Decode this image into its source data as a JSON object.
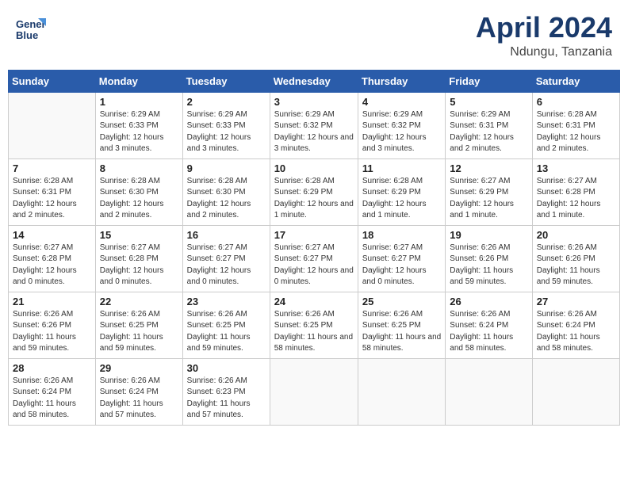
{
  "header": {
    "logo_text_1": "General",
    "logo_text_2": "Blue",
    "month": "April 2024",
    "location": "Ndungu, Tanzania"
  },
  "days_of_week": [
    "Sunday",
    "Monday",
    "Tuesday",
    "Wednesday",
    "Thursday",
    "Friday",
    "Saturday"
  ],
  "weeks": [
    [
      {
        "day": "",
        "info": ""
      },
      {
        "day": "1",
        "info": "Sunrise: 6:29 AM\nSunset: 6:33 PM\nDaylight: 12 hours\nand 3 minutes."
      },
      {
        "day": "2",
        "info": "Sunrise: 6:29 AM\nSunset: 6:33 PM\nDaylight: 12 hours\nand 3 minutes."
      },
      {
        "day": "3",
        "info": "Sunrise: 6:29 AM\nSunset: 6:32 PM\nDaylight: 12 hours\nand 3 minutes."
      },
      {
        "day": "4",
        "info": "Sunrise: 6:29 AM\nSunset: 6:32 PM\nDaylight: 12 hours\nand 3 minutes."
      },
      {
        "day": "5",
        "info": "Sunrise: 6:29 AM\nSunset: 6:31 PM\nDaylight: 12 hours\nand 2 minutes."
      },
      {
        "day": "6",
        "info": "Sunrise: 6:28 AM\nSunset: 6:31 PM\nDaylight: 12 hours\nand 2 minutes."
      }
    ],
    [
      {
        "day": "7",
        "info": "Sunrise: 6:28 AM\nSunset: 6:31 PM\nDaylight: 12 hours\nand 2 minutes."
      },
      {
        "day": "8",
        "info": "Sunrise: 6:28 AM\nSunset: 6:30 PM\nDaylight: 12 hours\nand 2 minutes."
      },
      {
        "day": "9",
        "info": "Sunrise: 6:28 AM\nSunset: 6:30 PM\nDaylight: 12 hours\nand 2 minutes."
      },
      {
        "day": "10",
        "info": "Sunrise: 6:28 AM\nSunset: 6:29 PM\nDaylight: 12 hours\nand 1 minute."
      },
      {
        "day": "11",
        "info": "Sunrise: 6:28 AM\nSunset: 6:29 PM\nDaylight: 12 hours\nand 1 minute."
      },
      {
        "day": "12",
        "info": "Sunrise: 6:27 AM\nSunset: 6:29 PM\nDaylight: 12 hours\nand 1 minute."
      },
      {
        "day": "13",
        "info": "Sunrise: 6:27 AM\nSunset: 6:28 PM\nDaylight: 12 hours\nand 1 minute."
      }
    ],
    [
      {
        "day": "14",
        "info": "Sunrise: 6:27 AM\nSunset: 6:28 PM\nDaylight: 12 hours\nand 0 minutes."
      },
      {
        "day": "15",
        "info": "Sunrise: 6:27 AM\nSunset: 6:28 PM\nDaylight: 12 hours\nand 0 minutes."
      },
      {
        "day": "16",
        "info": "Sunrise: 6:27 AM\nSunset: 6:27 PM\nDaylight: 12 hours\nand 0 minutes."
      },
      {
        "day": "17",
        "info": "Sunrise: 6:27 AM\nSunset: 6:27 PM\nDaylight: 12 hours\nand 0 minutes."
      },
      {
        "day": "18",
        "info": "Sunrise: 6:27 AM\nSunset: 6:27 PM\nDaylight: 12 hours\nand 0 minutes."
      },
      {
        "day": "19",
        "info": "Sunrise: 6:26 AM\nSunset: 6:26 PM\nDaylight: 11 hours\nand 59 minutes."
      },
      {
        "day": "20",
        "info": "Sunrise: 6:26 AM\nSunset: 6:26 PM\nDaylight: 11 hours\nand 59 minutes."
      }
    ],
    [
      {
        "day": "21",
        "info": "Sunrise: 6:26 AM\nSunset: 6:26 PM\nDaylight: 11 hours\nand 59 minutes."
      },
      {
        "day": "22",
        "info": "Sunrise: 6:26 AM\nSunset: 6:25 PM\nDaylight: 11 hours\nand 59 minutes."
      },
      {
        "day": "23",
        "info": "Sunrise: 6:26 AM\nSunset: 6:25 PM\nDaylight: 11 hours\nand 59 minutes."
      },
      {
        "day": "24",
        "info": "Sunrise: 6:26 AM\nSunset: 6:25 PM\nDaylight: 11 hours\nand 58 minutes."
      },
      {
        "day": "25",
        "info": "Sunrise: 6:26 AM\nSunset: 6:25 PM\nDaylight: 11 hours\nand 58 minutes."
      },
      {
        "day": "26",
        "info": "Sunrise: 6:26 AM\nSunset: 6:24 PM\nDaylight: 11 hours\nand 58 minutes."
      },
      {
        "day": "27",
        "info": "Sunrise: 6:26 AM\nSunset: 6:24 PM\nDaylight: 11 hours\nand 58 minutes."
      }
    ],
    [
      {
        "day": "28",
        "info": "Sunrise: 6:26 AM\nSunset: 6:24 PM\nDaylight: 11 hours\nand 58 minutes."
      },
      {
        "day": "29",
        "info": "Sunrise: 6:26 AM\nSunset: 6:24 PM\nDaylight: 11 hours\nand 57 minutes."
      },
      {
        "day": "30",
        "info": "Sunrise: 6:26 AM\nSunset: 6:23 PM\nDaylight: 11 hours\nand 57 minutes."
      },
      {
        "day": "",
        "info": ""
      },
      {
        "day": "",
        "info": ""
      },
      {
        "day": "",
        "info": ""
      },
      {
        "day": "",
        "info": ""
      }
    ]
  ]
}
